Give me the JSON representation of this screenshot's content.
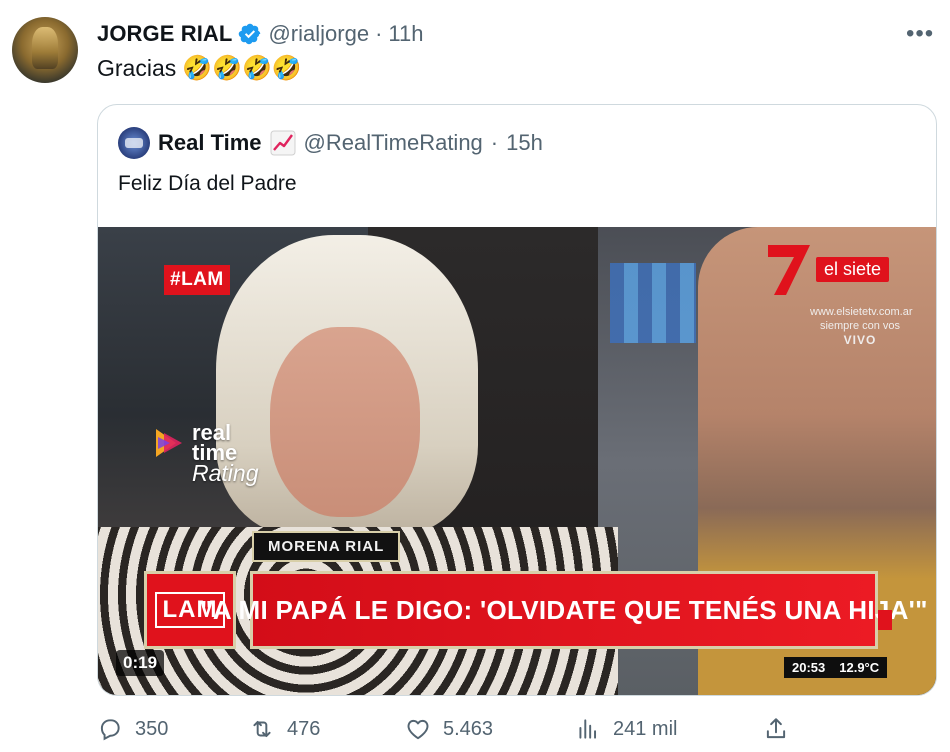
{
  "tweet": {
    "author_name": "JORGE RIAL",
    "handle": "@rialjorge",
    "separator": "·",
    "time": "11h",
    "more_label": "•••",
    "text": "Gracias",
    "emojis": "🤣🤣🤣🤣",
    "verified_color": "#1d9bf0"
  },
  "quote": {
    "author_name": "Real Time",
    "handle": "@RealTimeRating",
    "separator": "·",
    "time": "15h",
    "text": "Feliz Día del Padre",
    "video": {
      "hashtag": "#LAM",
      "channel_name": "el siete",
      "channel_url": "www.elsietetv.com.ar",
      "channel_tagline": "siempre con vos",
      "channel_live": "VIVO",
      "watermark_line1": "real",
      "watermark_line2": "time",
      "watermark_line3": "Rating",
      "name_tag": "MORENA RIAL",
      "lam_logo": "LAM",
      "headline": "\"A MI PAPÁ LE DIGO: 'OLVIDATE QUE TENÉS UNA HIJA'\"",
      "clock_time": "20:53",
      "clock_temp": "12.9°C",
      "duration": "0:19"
    }
  },
  "actions": {
    "replies": "350",
    "retweets": "476",
    "likes": "5.463",
    "views": "241 mil"
  },
  "colors": {
    "text_secondary": "#536471",
    "border": "#cfd9de",
    "brand_red": "#e0121c"
  }
}
